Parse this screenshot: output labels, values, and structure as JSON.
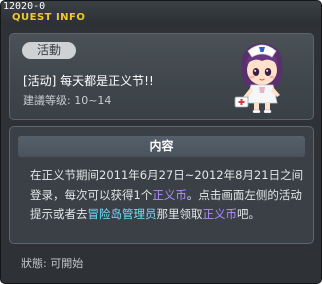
{
  "quest_id": "12020-0",
  "window_title": "QUEST INFO",
  "category_tag": "活動",
  "quest_name": "[活动] 每天都是正义节!!",
  "recommended_level": "建議等级: 10~14",
  "content_heading": "内容",
  "description": {
    "part1": "在正义节期间2011年6月27日~2012年8月21日之间登录，每次可以获得1个",
    "currency": "正义币",
    "part2": "。点击画面左侧的活动提示或者去",
    "npc": "冒险岛管理员",
    "part3": "那里领取",
    "currency2": "正义币",
    "part4": "吧。"
  },
  "status": "狀態: 可開始",
  "colors": {
    "title": "#f2c82f",
    "currency_highlight": "#b18cff",
    "npc_highlight": "#6fe0ff"
  },
  "icons": {
    "npc_portrait": "nurse-npc-portrait"
  }
}
